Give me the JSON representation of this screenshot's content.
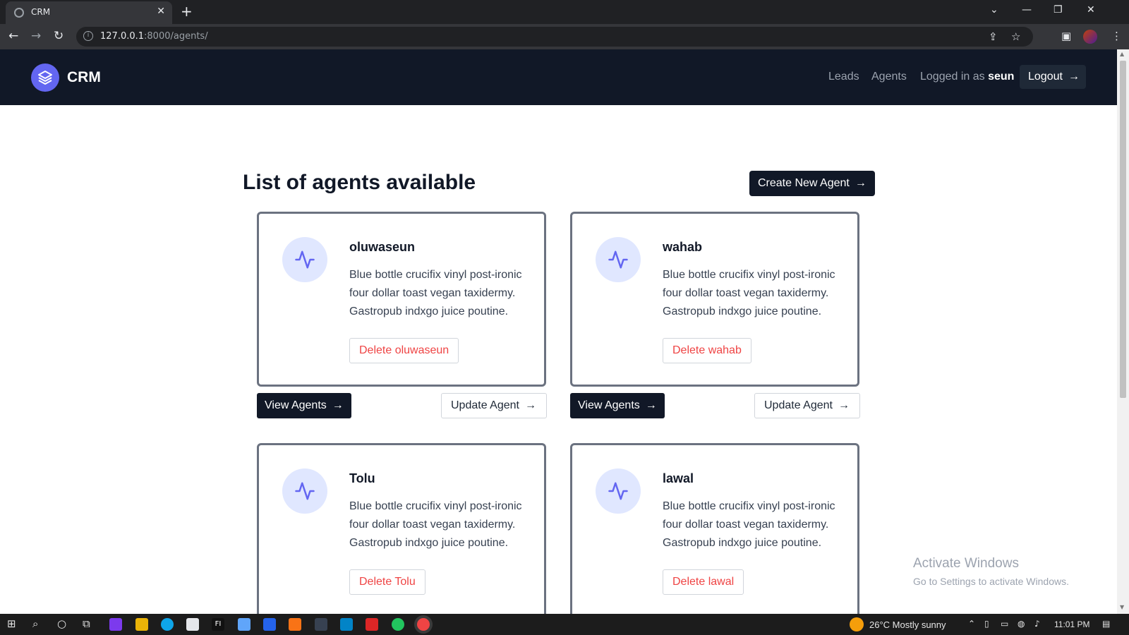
{
  "browser": {
    "tab_title": "CRM",
    "tab_close": "✕",
    "new_tab": "+",
    "url_host": "127.0.0.1",
    "url_rest": ":8000/agents/",
    "window_controls": [
      "⌄",
      "—",
      "❐",
      "✕"
    ],
    "nav": {
      "back": "←",
      "forward": "→",
      "reload": "↻"
    },
    "toolbar_icons": [
      "share-icon",
      "star-icon",
      "side-panel-icon",
      "avatar",
      "menu-icon"
    ]
  },
  "site": {
    "logo_text": "CRM",
    "nav": {
      "leads": "Leads",
      "agents": "Agents"
    },
    "logged_in_prefix": "Logged in as ",
    "username": "seun",
    "logout_label": "Logout",
    "arrow": "→",
    "page_title": "List of agents available",
    "create_label": "Create New Agent",
    "view_label": "View Agents",
    "update_label": "Update Agent",
    "delete_prefix": "Delete ",
    "description": "Blue bottle crucifix vinyl post-ironic four dollar toast vegan taxidermy. Gastropub indxgo juice poutine.",
    "agents": [
      "oluwaseun",
      "wahab",
      "Tolu",
      "lawal"
    ],
    "colors": {
      "header": "#111827",
      "accent": "#6366f1",
      "danger": "#ef4444"
    }
  },
  "watermark": {
    "title": "Activate Windows",
    "subtitle": "Go to Settings to activate Windows."
  },
  "taskbar": {
    "weather": "26°C  Mostly sunny",
    "time": "11:01 PM",
    "apps": [
      "windows-icon",
      "search-icon",
      "cortana-icon",
      "task-view-icon",
      "app-icon",
      "file-explorer-icon",
      "edge-icon",
      "store-icon",
      "fl-studio-icon",
      "image-app-icon",
      "vscode-icon",
      "vlc-icon",
      "terminal-icon",
      "mail-icon",
      "acrobat-icon",
      "chrome-icon",
      "chrome-active-icon"
    ]
  }
}
